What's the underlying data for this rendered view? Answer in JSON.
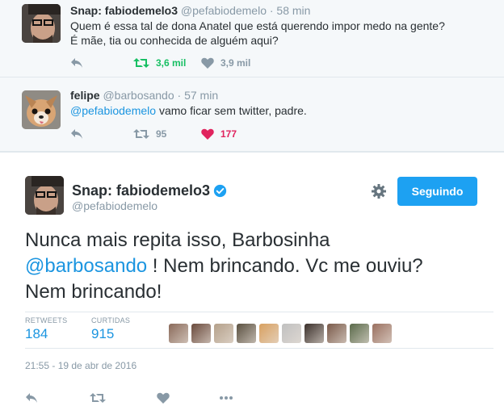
{
  "reply1": {
    "name": "Snap: fabiodemelo3",
    "handle": "@pefabiodemelo",
    "time": "· 58 min",
    "line1": "Quem é essa tal de dona Anatel que está querendo impor medo na gente?",
    "line2": "É mãe, tia ou conhecida de alguém aqui?",
    "retweets": "3,6 mil",
    "likes": "3,9 mil"
  },
  "reply2": {
    "name": "felipe",
    "handle": "@barbosando",
    "time": "· 57 min",
    "mention": "@pefabiodemelo",
    "text": " vamo ficar sem twitter, padre.",
    "retweets": "95",
    "likes": "177"
  },
  "main": {
    "name": "Snap: fabiodemelo3",
    "handle": "@pefabiodemelo",
    "follow_label": "Seguindo",
    "text_line1": "Nunca mais repita isso, Barbosinha",
    "mention": "@barbosando",
    "text_line2_rest": " ! Nem brincando. Vc me ouviu?",
    "text_line3": "Nem brincando!",
    "retweets_label": "RETWEETS",
    "retweets_value": "184",
    "likes_label": "CURTIDAS",
    "likes_value": "915",
    "timestamp": "21:55 - 19 de abr de 2016"
  },
  "colors": {
    "accent": "#1da1f2",
    "retweet_green": "#17bf63",
    "heart_red": "#e0245e",
    "muted": "#8899a6"
  },
  "likers": [
    "#8a6a5a",
    "#6a4a3c",
    "#b4a08a",
    "#5a5040",
    "#d8a060",
    "#c0c0c0",
    "#3a2f2a",
    "#7a5a4a",
    "#5a6a4a",
    "#9a7060"
  ]
}
